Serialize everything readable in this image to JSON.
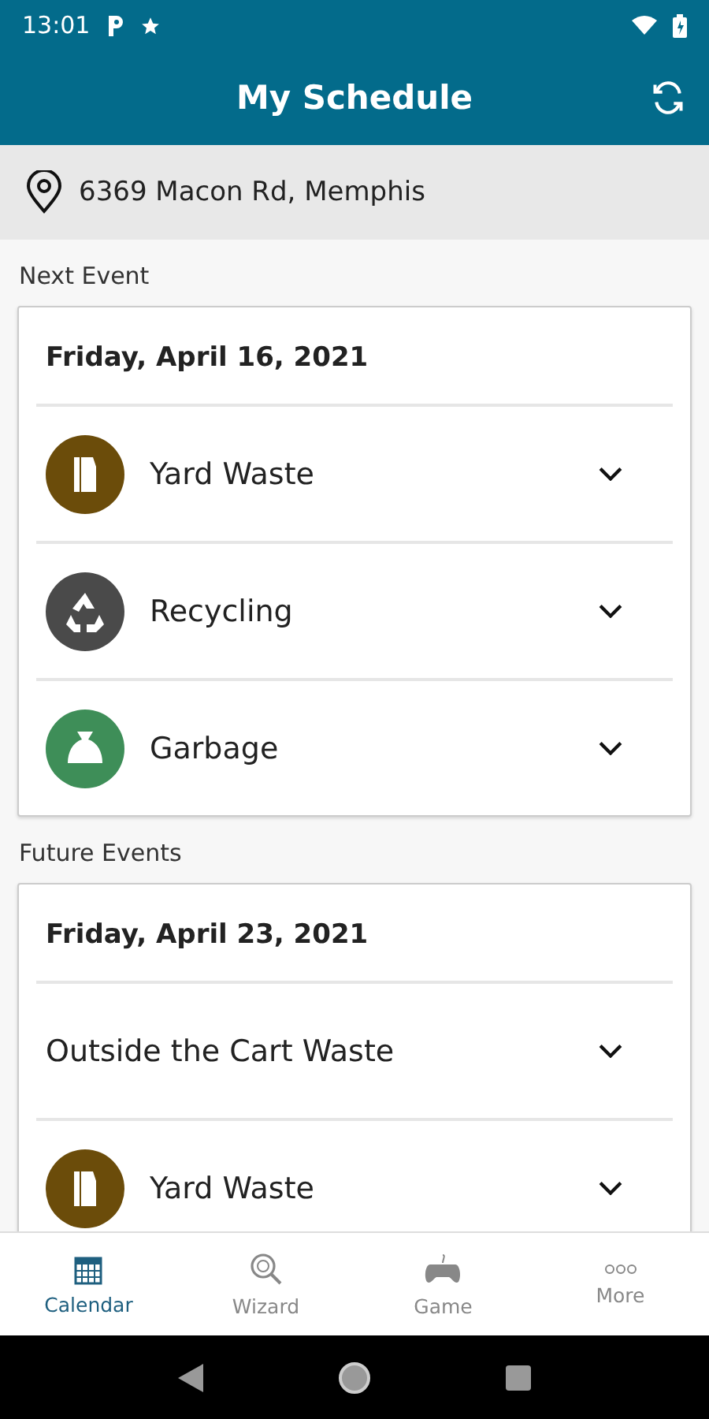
{
  "status_bar": {
    "time": "13:01"
  },
  "app_bar": {
    "title": "My Schedule"
  },
  "location": {
    "address": "6369 Macon Rd, Memphis"
  },
  "sections": [
    {
      "heading": "Next Event",
      "events": [
        {
          "date": "Friday, April 16, 2021",
          "items": [
            {
              "kind": "yard",
              "label": "Yard Waste"
            },
            {
              "kind": "recycling",
              "label": "Recycling"
            },
            {
              "kind": "garbage",
              "label": "Garbage"
            }
          ]
        }
      ]
    },
    {
      "heading": "Future Events",
      "events": [
        {
          "date": "Friday, April 23, 2021",
          "items": [
            {
              "kind": "plain",
              "label": "Outside the Cart Waste"
            },
            {
              "kind": "yard",
              "label": "Yard Waste"
            }
          ]
        }
      ]
    }
  ],
  "bottom_nav": [
    {
      "kind": "calendar",
      "label": "Calendar",
      "selected": true
    },
    {
      "kind": "wizard",
      "label": "Wizard",
      "selected": false
    },
    {
      "kind": "game",
      "label": "Game",
      "selected": false
    },
    {
      "kind": "more",
      "label": "More",
      "selected": false
    }
  ]
}
